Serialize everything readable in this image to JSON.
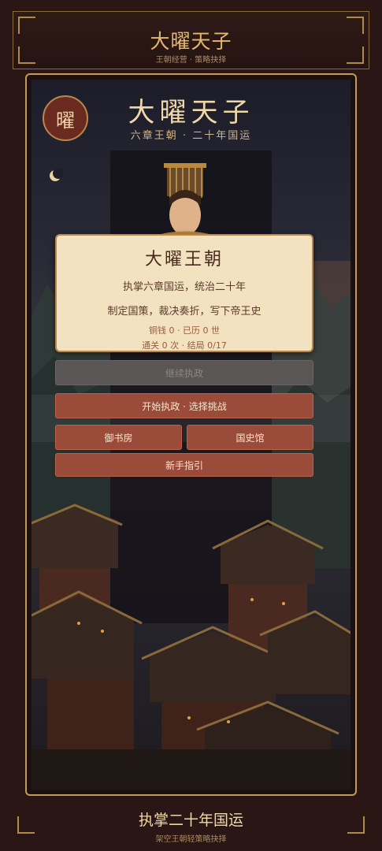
{
  "header": {
    "title": "大曜天子",
    "subtitle": "王朝经营 · 策略抉择"
  },
  "scene": {
    "emblem_char": "曜",
    "title": "大曜天子",
    "subtitle": "六章王朝 · 二十年国运"
  },
  "card": {
    "title": "大曜王朝",
    "line1": "执掌六章国运，统治二十年",
    "line2": "制定国策，裁决奏折，写下帝王史",
    "stat1": "铜钱 0 · 已历 0 世",
    "stat2": "通关 0 次 · 结局 0/17"
  },
  "buttons": {
    "continue": "继续执政",
    "start": "开始执政 · 选择挑战",
    "study": "御书房",
    "history": "国史馆",
    "guide": "新手指引"
  },
  "footer": {
    "title": "执掌二十年国运",
    "subtitle": "架空王朝轻策略抉择"
  },
  "colors": {
    "accent_gold": "#c29a55",
    "button_red": "#9b4b3a",
    "card_bg": "#f3e2c0",
    "page_bg": "#2a1715"
  }
}
